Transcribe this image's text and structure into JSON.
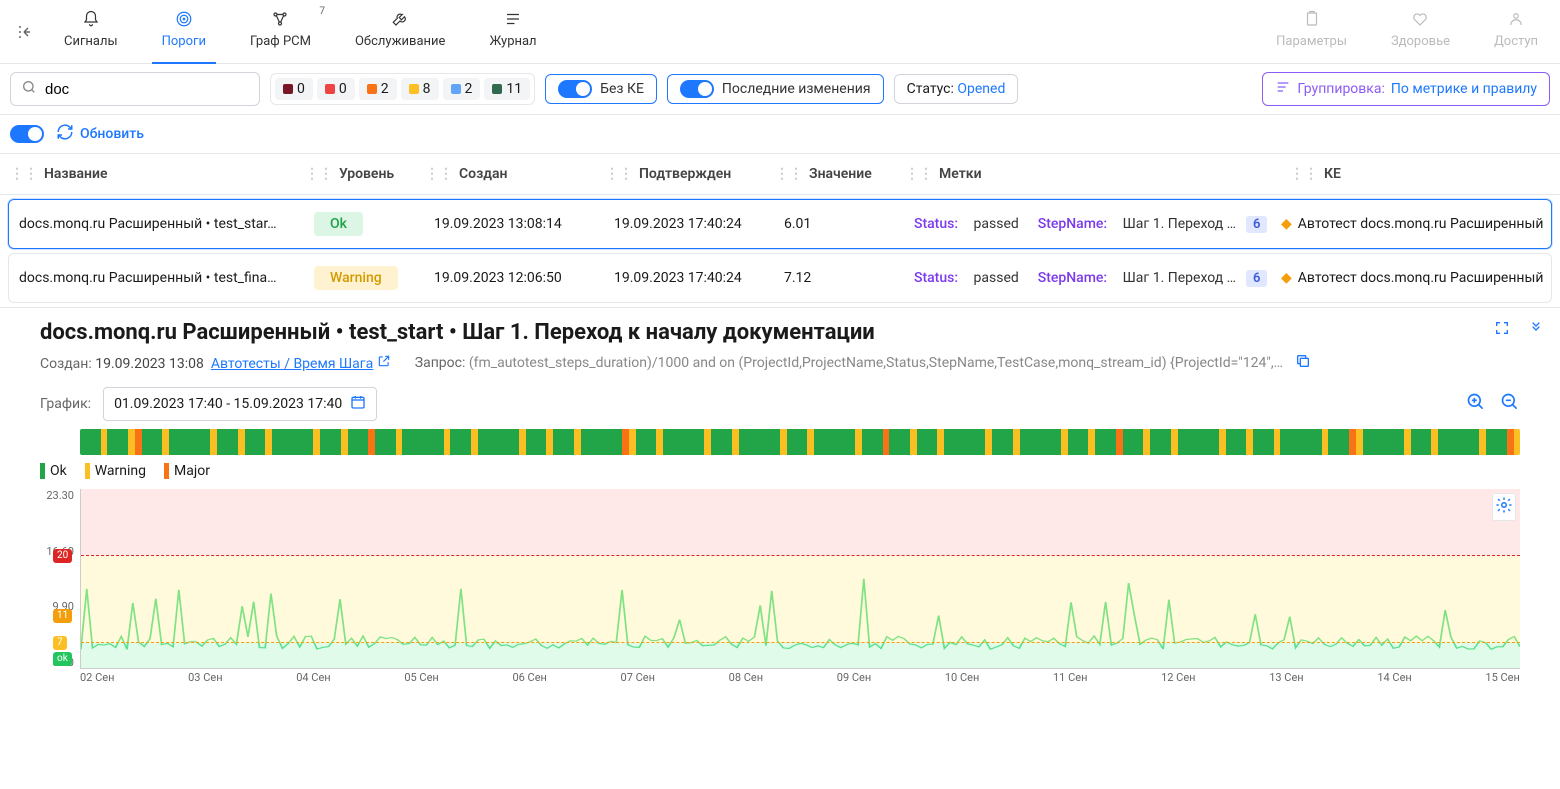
{
  "tabs": {
    "signals": "Сигналы",
    "thresholds": "Пороги",
    "rcm": "Граф РСМ",
    "rcm_badge": "7",
    "maintenance": "Обслуживание",
    "journal": "Журнал",
    "params": "Параметры",
    "health": "Здоровье",
    "access": "Доступ"
  },
  "filters": {
    "search_value": "doc",
    "chips": [
      {
        "color": "#7a1726",
        "count": "0"
      },
      {
        "color": "#ef4444",
        "count": "0"
      },
      {
        "color": "#f97316",
        "count": "2"
      },
      {
        "color": "#fbbf24",
        "count": "8"
      },
      {
        "color": "#60a5fa",
        "count": "2"
      },
      {
        "color": "#30694d",
        "count": "11"
      }
    ],
    "no_ke": "Без КЕ",
    "last_changes": "Последние изменения",
    "status_label": "Статус:",
    "status_value": "Opened",
    "group_label": "Группировка:",
    "group_value": "По метрике и правилу"
  },
  "refresh": {
    "label": "Обновить"
  },
  "columns": {
    "name": "Название",
    "level": "Уровень",
    "created": "Создан",
    "confirmed": "Подтвержден",
    "value": "Значение",
    "tags": "Метки",
    "ke": "КЕ"
  },
  "rows": [
    {
      "name": "docs.monq.ru Расширенный • test_star…",
      "level": "Ok",
      "level_class": "lvl-ok",
      "created": "19.09.2023 13:08:14",
      "confirmed": "19.09.2023 17:40:24",
      "value": "6.01",
      "tags": [
        {
          "k": "Status:",
          "v": "passed"
        },
        {
          "k": "StepName:",
          "v": "Шаг 1. Переход …"
        }
      ],
      "tag_count": "6",
      "ke": "Автотест docs.monq.ru Расширенный"
    },
    {
      "name": "docs.monq.ru Расширенный • test_fina…",
      "level": "Warning",
      "level_class": "lvl-warn",
      "created": "19.09.2023 12:06:50",
      "confirmed": "19.09.2023 17:40:24",
      "value": "7.12",
      "tags": [
        {
          "k": "Status:",
          "v": "passed"
        },
        {
          "k": "StepName:",
          "v": "Шаг 1. Переход …"
        }
      ],
      "tag_count": "6",
      "ke": "Автотест docs.monq.ru Расширенный"
    }
  ],
  "detail": {
    "title": "docs.monq.ru Расширенный • test_start • Шаг 1. Переход к началу документации",
    "created_label": "Создан:",
    "created_value": "19.09.2023 13:08",
    "link_text": "Автотесты / Время Шага",
    "query_label": "Запрос:",
    "query_value": "(fm_autotest_steps_duration)/1000 and on (ProjectId,ProjectName,Status,StepName,TestCase,monq_stream_id) {ProjectId=\"124\",ProjectName=\"docs.…",
    "chart_label": "График:",
    "date_range": "01.09.2023 17:40 - 15.09.2023 17:40",
    "legend": {
      "ok": "Ok",
      "warning": "Warning",
      "major": "Major"
    }
  },
  "chart_data": {
    "type": "line",
    "ylim": [
      3.2,
      30
    ],
    "yticks": [
      "23.30",
      "16.60",
      "9.90",
      "3.20"
    ],
    "thresholds": [
      {
        "value": 20,
        "color": "#dc2626",
        "label": "20"
      },
      {
        "value": 11,
        "color": "#f59e0b",
        "label": "11"
      },
      {
        "value": 7,
        "color": "#fbbf24",
        "label": "7"
      },
      {
        "value": 4.5,
        "label": "ok",
        "color": "#22c55e"
      }
    ],
    "x_categories": [
      "02 Сен",
      "03 Сен",
      "04 Сен",
      "05 Сен",
      "06 Сен",
      "07 Сен",
      "08 Сен",
      "09 Сен",
      "10 Сен",
      "11 Сен",
      "12 Сен",
      "13 Сен",
      "14 Сен",
      "15 Сен"
    ],
    "timeline_segments": [
      "g",
      "y",
      "g",
      "y",
      "o",
      "g",
      "y",
      "g",
      "g",
      "y",
      "g",
      "y",
      "g",
      "y",
      "g",
      "g",
      "y",
      "g",
      "y",
      "g",
      "o",
      "g",
      "y",
      "g",
      "g",
      "y",
      "g",
      "y",
      "g",
      "g",
      "y",
      "g",
      "y",
      "g",
      "y",
      "g",
      "g",
      "o",
      "y",
      "g",
      "y",
      "g",
      "g",
      "y",
      "g",
      "y",
      "g",
      "g",
      "y",
      "g",
      "y",
      "g",
      "g",
      "y",
      "g",
      "o",
      "g",
      "y",
      "g",
      "y",
      "g",
      "g",
      "y",
      "g",
      "y",
      "g",
      "g",
      "y",
      "g",
      "y",
      "g",
      "o",
      "g",
      "y",
      "g",
      "y",
      "g",
      "g",
      "y",
      "g",
      "y",
      "g",
      "y",
      "g",
      "g",
      "y",
      "g",
      "o",
      "y",
      "g",
      "g",
      "y",
      "g",
      "y",
      "g",
      "g",
      "y",
      "g",
      "o",
      "y"
    ]
  }
}
